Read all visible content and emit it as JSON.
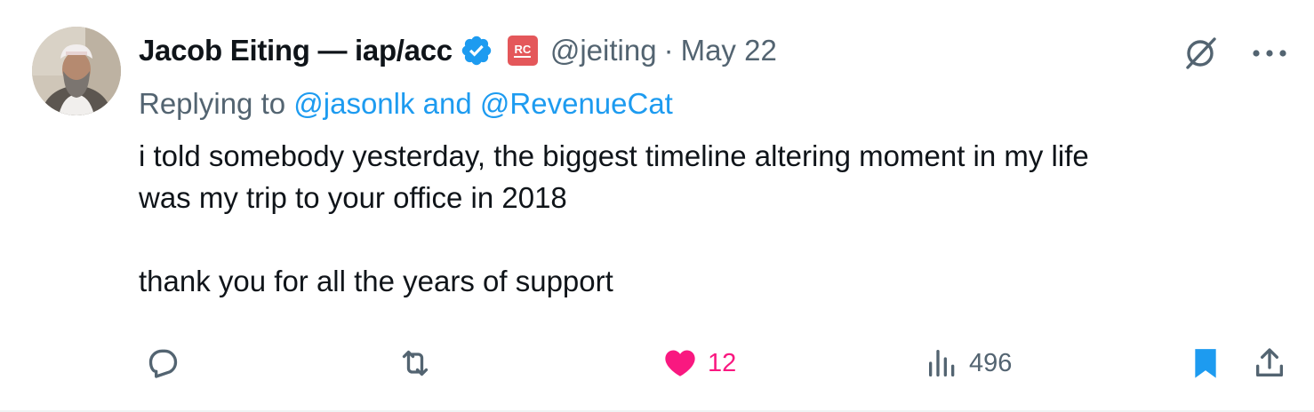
{
  "author": {
    "name": "Jacob Eiting — iap/acc",
    "handle": "@jeiting",
    "separator": "·",
    "date": "May 22",
    "affiliate_badge": "RC",
    "verified_icon": "verified-badge-icon"
  },
  "reply": {
    "prefix": "Replying to ",
    "mention_1": "@jasonlk",
    "conjunction": " and ",
    "mention_2": "@RevenueCat"
  },
  "tweet": {
    "text": "i told somebody yesterday, the biggest timeline altering moment in my life\nwas my trip to your office in 2018\n\nthank you for all the years of support"
  },
  "actions": {
    "replies": "",
    "retweets": "",
    "likes": "12",
    "views": "496"
  },
  "colors": {
    "accent": "#1d9bf0",
    "like": "#f91880",
    "secondary_text": "#536471",
    "affiliate_badge": "#e4575a"
  }
}
